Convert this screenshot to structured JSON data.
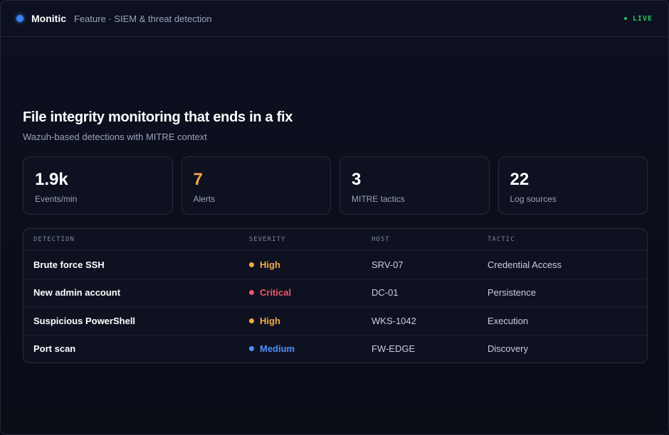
{
  "header": {
    "brand": "Monitic",
    "subtitle": "Feature · SIEM & threat detection",
    "live_label": "LIVE"
  },
  "hero": {
    "title": "File integrity monitoring that ends in a fix",
    "description": "Wazuh-based detections with MITRE context"
  },
  "stats": [
    {
      "value": "1.9k",
      "label": "Events/min"
    },
    {
      "value": "7",
      "label": "Alerts"
    },
    {
      "value": "3",
      "label": "MITRE tactics"
    },
    {
      "value": "22",
      "label": "Log sources"
    }
  ],
  "table": {
    "columns": [
      "DETECTION",
      "SEVERITY",
      "HOST",
      "TACTIC"
    ],
    "rows": [
      {
        "detection": "Brute force SSH",
        "severity": "High",
        "host": "SRV-07",
        "tactic": "Credential Access"
      },
      {
        "detection": "New admin account",
        "severity": "Critical",
        "host": "DC-01",
        "tactic": "Persistence"
      },
      {
        "detection": "Suspicious PowerShell",
        "severity": "High",
        "host": "WKS-1042",
        "tactic": "Execution"
      },
      {
        "detection": "Port scan",
        "severity": "Medium",
        "host": "FW-EDGE",
        "tactic": "Discovery"
      }
    ]
  },
  "colors": {
    "accent": "#3b82f6",
    "live": "#22c55e",
    "high": "#f5a844",
    "critical": "#f0566a",
    "medium": "#4f8ff7"
  }
}
